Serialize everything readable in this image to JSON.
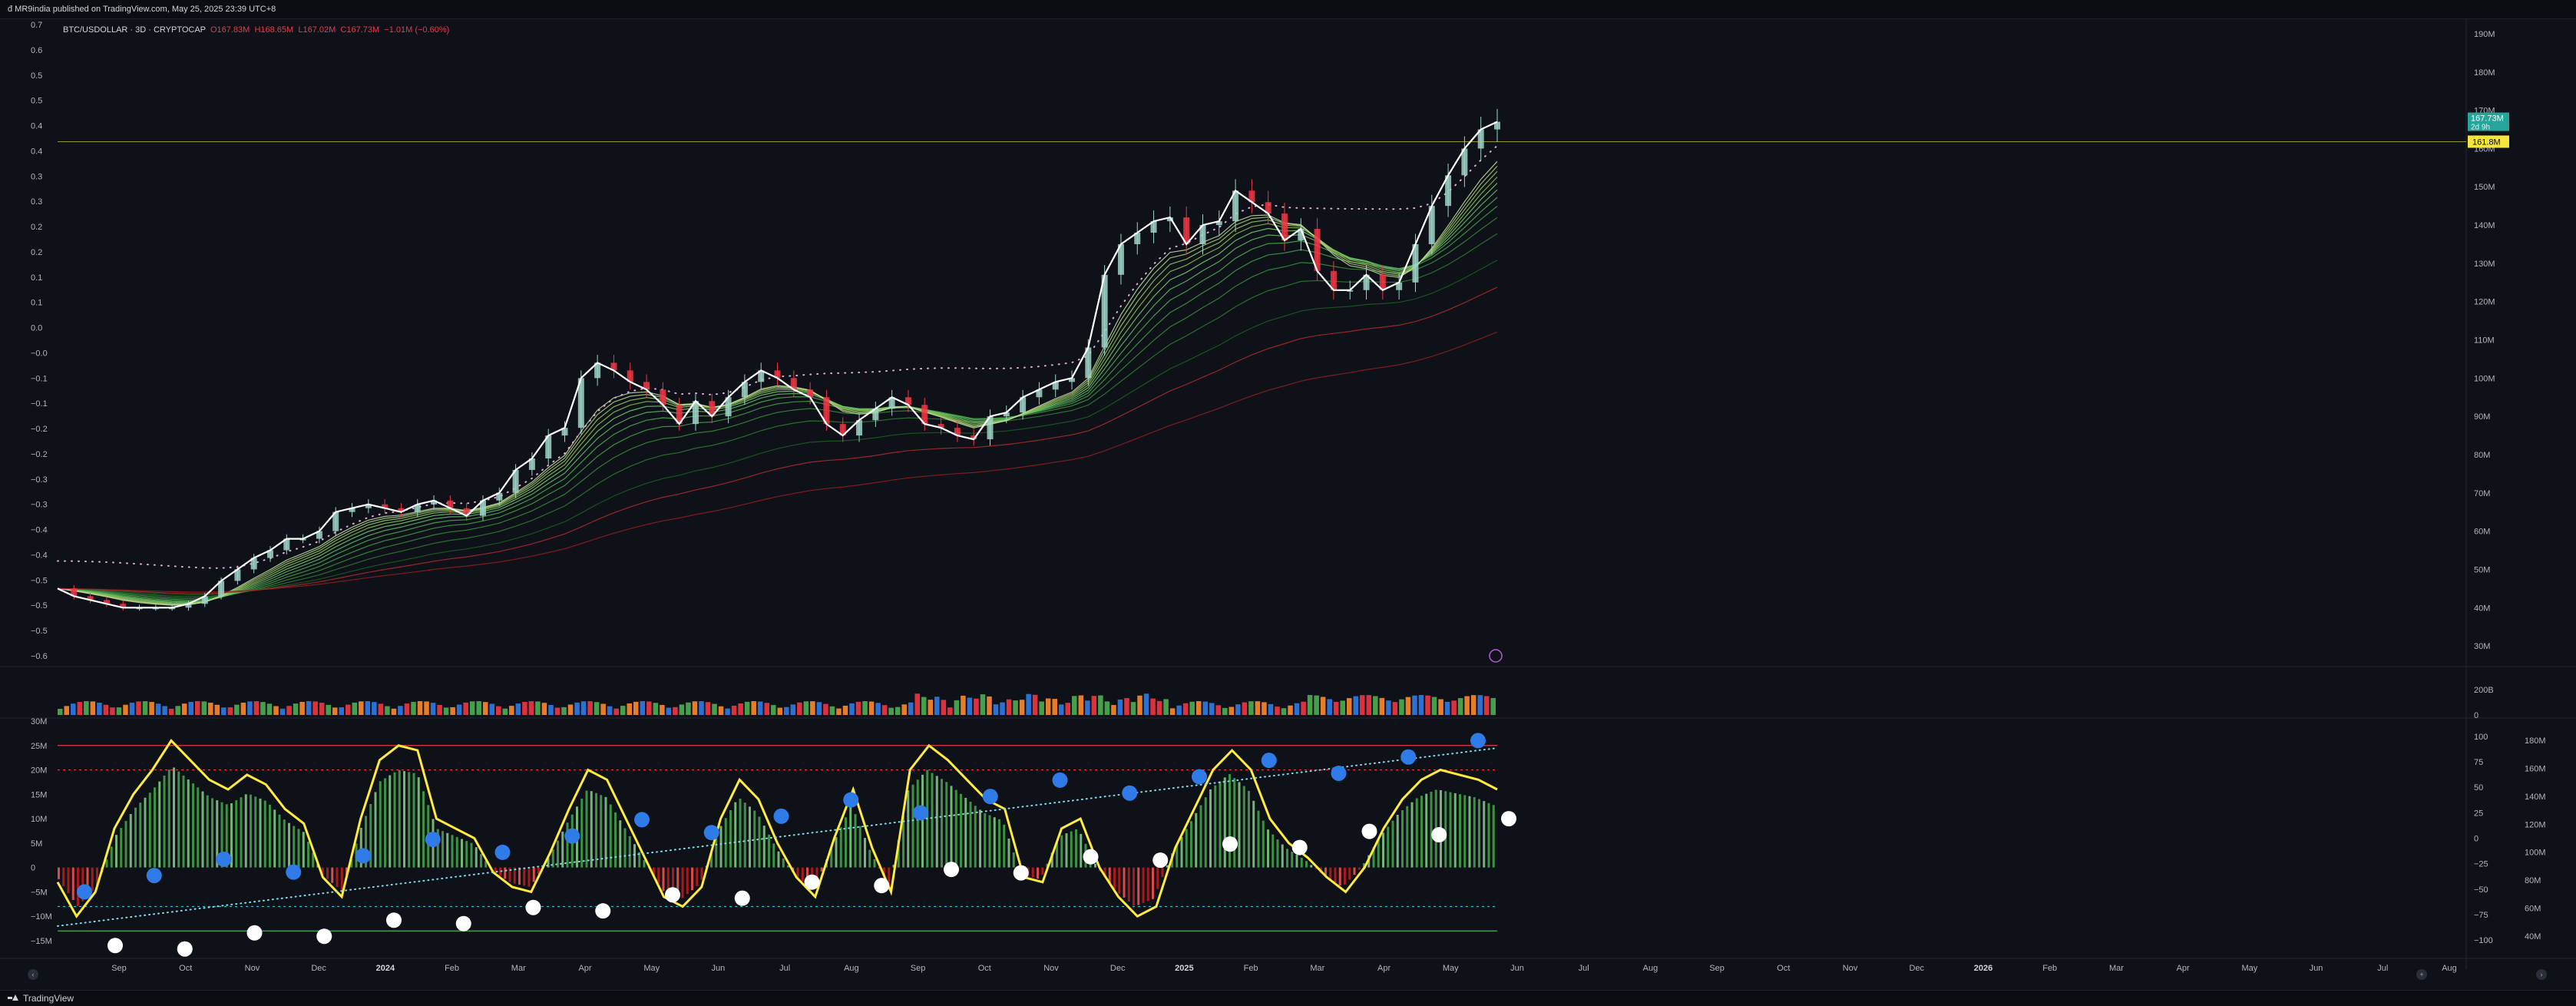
{
  "header": {
    "published": "đ MR9india published on TradingView.com, May 25, 2025 23:39 UTC+8"
  },
  "legend": {
    "symbol": "BTC/USDOLLAR · 3D · CRYPTOCAP",
    "open": "O167.83M",
    "high": "H168.65M",
    "low": "L167.02M",
    "close": "C167.73M",
    "change": "−1.01M (−0.60%)"
  },
  "footer": {
    "brand": "TradingView"
  },
  "colors": {
    "background": "#0e1118",
    "price_line": "#ffffff",
    "oscillator_line": "#ffeb3b",
    "bull": "#4caf50",
    "bear": "#f23645",
    "blue_dot": "#2f7be8",
    "white_dot": "#ffffff",
    "price_tag": "#26a69a",
    "level_tag": "#f7e63a"
  },
  "chart_data": [
    {
      "type": "line",
      "name": "price_pane",
      "x_ticks": [
        "Sep",
        "Oct",
        "Nov",
        "Dec",
        "2024",
        "Feb",
        "Mar",
        "Apr",
        "May",
        "Jun",
        "Jul",
        "Aug",
        "Sep",
        "Oct",
        "Nov",
        "Dec",
        "2025",
        "Feb",
        "Mar",
        "Apr",
        "May",
        "Jun",
        "Jul",
        "Aug",
        "Sep",
        "Oct",
        "Nov",
        "Dec",
        "2026",
        "Feb",
        "Mar",
        "Apr",
        "May",
        "Jun",
        "Jul",
        "Aug"
      ],
      "right_axis": {
        "ticks": [
          "190M",
          "180M",
          "170M",
          "160M",
          "150M",
          "140M",
          "130M",
          "120M",
          "110M",
          "100M",
          "90M",
          "80M",
          "70M",
          "60M",
          "50M",
          "40M",
          "30M"
        ],
        "ylim": [
          25,
          192
        ],
        "current_price_tag": [
          "167.73M",
          "2d 9h"
        ],
        "level_tag": "161.8M"
      },
      "left_axis": {
        "ticks": [
          "0.7",
          "0.6",
          "0.5",
          "0.5",
          "0.4",
          "0.4",
          "0.3",
          "0.3",
          "0.2",
          "0.2",
          "0.1",
          "0.1",
          "0.0",
          "−0.0",
          "−0.1",
          "−0.1",
          "−0.2",
          "−0.2",
          "−0.3",
          "−0.3",
          "−0.4",
          "−0.4",
          "−0.5",
          "−0.5",
          "−0.5",
          "−0.6"
        ]
      },
      "series": [
        {
          "values": [
            45,
            43,
            42,
            41,
            40,
            40,
            40,
            40,
            41,
            43,
            47,
            50,
            53,
            55,
            58,
            58,
            60,
            65,
            66,
            67,
            66,
            65,
            67,
            68,
            66,
            64,
            68,
            70,
            76,
            79,
            85,
            87,
            100,
            104,
            102,
            99,
            97,
            93,
            88,
            94,
            90,
            95,
            99,
            102,
            100,
            97,
            95,
            88,
            85,
            89,
            92,
            95,
            93,
            88,
            87,
            85,
            84,
            90,
            91,
            95,
            97,
            99,
            100,
            108,
            127,
            135,
            138,
            141,
            142,
            135,
            140,
            141,
            149,
            146,
            143,
            136,
            139,
            128,
            123,
            123,
            127,
            123,
            125,
            135,
            145,
            153,
            160,
            165,
            167
          ]
        }
      ]
    },
    {
      "type": "bar",
      "name": "volume_pane",
      "axis_ticks": [
        "200B",
        "0"
      ]
    },
    {
      "type": "line",
      "name": "oscillator_pane",
      "left_axis": {
        "ticks": [
          "30M",
          "25M",
          "20M",
          "15M",
          "10M",
          "5M",
          "0",
          "−5M",
          "−10M",
          "−15M"
        ],
        "ylim": [
          -18,
          30
        ]
      },
      "middle_axis": {
        "ticks": [
          "100",
          "75",
          "50",
          "25",
          "0",
          "−25",
          "−50",
          "−75",
          "−100"
        ],
        "ylim": [
          -115,
          115
        ]
      },
      "right_axis": {
        "ticks": [
          "180M",
          "160M",
          "140M",
          "120M",
          "100M",
          "80M",
          "60M",
          "40M"
        ]
      },
      "reference_levels": [
        25,
        20,
        -8,
        -13
      ],
      "series": [
        {
          "values": [
            -3,
            -10,
            -5,
            8,
            15,
            20,
            26,
            22,
            18,
            16,
            19,
            17,
            12,
            9,
            -2,
            -6,
            10,
            22,
            25,
            24,
            10,
            8,
            6,
            -1,
            -4,
            -5,
            3,
            12,
            20,
            18,
            10,
            2,
            -6,
            -8,
            -4,
            10,
            18,
            14,
            5,
            -2,
            -6,
            6,
            16,
            4,
            -5,
            20,
            25,
            22,
            18,
            14,
            12,
            -2,
            -3,
            8,
            10,
            0,
            -6,
            -10,
            -8,
            4,
            12,
            20,
            24,
            20,
            10,
            5,
            2,
            -2,
            -5,
            0,
            8,
            14,
            18,
            20,
            19,
            18,
            16
          ]
        }
      ]
    }
  ]
}
